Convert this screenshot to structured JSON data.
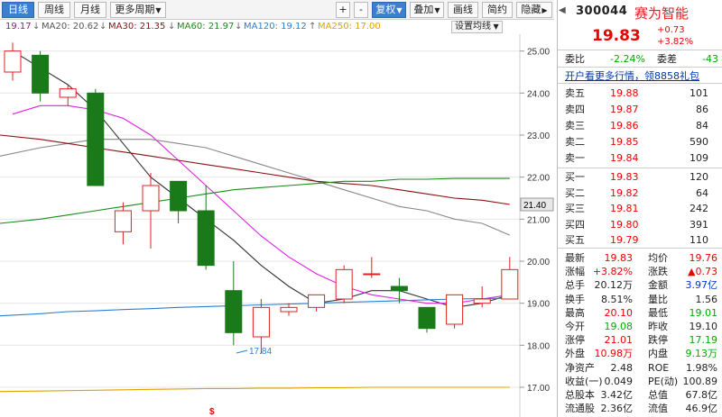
{
  "toolbar": {
    "tabs": [
      {
        "label": "日线",
        "active": true
      },
      {
        "label": "周线",
        "active": false
      },
      {
        "label": "月线",
        "active": false
      },
      {
        "label": "更多周期",
        "active": false
      }
    ],
    "buttons": [
      "+",
      "-",
      "复权",
      "叠加",
      "画线",
      "简约",
      "隐藏"
    ]
  },
  "ma": {
    "price": {
      "label": "19.17",
      "color": "#8b1a8b"
    },
    "ma20": {
      "label": "MA20: 20.62",
      "color": "#555555"
    },
    "ma30": {
      "label": "MA30: 21.35",
      "color": "#8b1010"
    },
    "ma60": {
      "label": "MA60: 21.97",
      "color": "#1a8a1a"
    },
    "ma120": {
      "label": "MA120: 19.12",
      "color": "#2a7fd4"
    },
    "ma250": {
      "label": "MA250: 17.00",
      "color": "#e0a000"
    },
    "settings": "设置均线"
  },
  "chart_data": {
    "type": "candlestick",
    "yticks": [
      "25.00",
      "24.00",
      "23.00",
      "22.00",
      "21.00",
      "20.00",
      "19.00",
      "18.00",
      "17.00"
    ],
    "ylim": [
      16.4,
      25.4
    ],
    "current_label": "21.40",
    "low_marker": "17.84",
    "candles": [
      {
        "o": 24.5,
        "h": 25.2,
        "l": 24.3,
        "c": 25.0
      },
      {
        "o": 24.9,
        "h": 25.0,
        "l": 23.8,
        "c": 24.0
      },
      {
        "o": 23.9,
        "h": 24.2,
        "l": 23.7,
        "c": 24.1
      },
      {
        "o": 24.0,
        "h": 24.1,
        "l": 21.8,
        "c": 21.8
      },
      {
        "o": 20.7,
        "h": 21.4,
        "l": 20.4,
        "c": 21.2
      },
      {
        "o": 21.2,
        "h": 22.1,
        "l": 20.3,
        "c": 21.8
      },
      {
        "o": 21.9,
        "h": 21.9,
        "l": 20.9,
        "c": 21.2
      },
      {
        "o": 21.2,
        "h": 21.8,
        "l": 19.8,
        "c": 19.9
      },
      {
        "o": 19.3,
        "h": 20.0,
        "l": 18.0,
        "c": 18.3
      },
      {
        "o": 18.2,
        "h": 19.1,
        "l": 17.8,
        "c": 18.9
      },
      {
        "o": 18.8,
        "h": 19.0,
        "l": 18.7,
        "c": 18.9
      },
      {
        "o": 18.9,
        "h": 19.2,
        "l": 18.8,
        "c": 19.2
      },
      {
        "o": 19.1,
        "h": 19.9,
        "l": 19.0,
        "c": 19.8
      },
      {
        "o": 19.7,
        "h": 20.1,
        "l": 19.6,
        "c": 19.7
      },
      {
        "o": 19.4,
        "h": 19.6,
        "l": 19.0,
        "c": 19.3
      },
      {
        "o": 18.9,
        "h": 18.9,
        "l": 18.3,
        "c": 18.4
      },
      {
        "o": 18.5,
        "h": 19.2,
        "l": 18.4,
        "c": 19.2
      },
      {
        "o": 19.0,
        "h": 19.4,
        "l": 18.9,
        "c": 19.1
      },
      {
        "o": 19.1,
        "h": 20.1,
        "l": 19.1,
        "c": 19.8
      }
    ],
    "ma_lines": {
      "ma5": [
        25.0,
        24.6,
        24.2,
        23.6,
        22.8,
        22.0,
        21.5,
        21.0,
        20.5,
        19.9,
        19.4,
        19.0,
        19.1,
        19.3,
        19.3,
        19.1,
        18.9,
        19.0,
        19.2
      ],
      "ma10": [
        23.5,
        23.7,
        23.7,
        23.6,
        23.4,
        23.0,
        22.4,
        21.8,
        21.2,
        20.6,
        20.1,
        19.7,
        19.4,
        19.2,
        19.1,
        19.0,
        19.0,
        19.1,
        19.2
      ],
      "ma20": [
        22.5,
        22.7,
        22.8,
        22.9,
        22.9,
        22.9,
        22.8,
        22.7,
        22.5,
        22.3,
        22.1,
        21.9,
        21.7,
        21.5,
        21.3,
        21.2,
        21.0,
        20.9,
        20.62
      ],
      "ma30": [
        23.0,
        22.9,
        22.8,
        22.7,
        22.6,
        22.5,
        22.4,
        22.3,
        22.2,
        22.1,
        22.0,
        21.9,
        21.85,
        21.8,
        21.7,
        21.6,
        21.5,
        21.45,
        21.35
      ],
      "ma60": [
        20.9,
        21.0,
        21.1,
        21.2,
        21.3,
        21.4,
        21.5,
        21.6,
        21.7,
        21.75,
        21.8,
        21.85,
        21.9,
        21.9,
        21.95,
        21.95,
        21.97,
        21.97,
        21.97
      ],
      "ma120": [
        18.7,
        18.75,
        18.8,
        18.82,
        18.85,
        18.87,
        18.9,
        18.92,
        18.94,
        18.96,
        18.98,
        19.0,
        19.02,
        19.04,
        19.06,
        19.08,
        19.1,
        19.11,
        19.12
      ],
      "ma250": [
        16.9,
        16.91,
        16.92,
        16.93,
        16.94,
        16.95,
        16.96,
        16.97,
        16.97,
        16.98,
        16.98,
        16.99,
        16.99,
        17.0,
        17.0,
        17.0,
        17.0,
        17.0,
        17.0
      ]
    }
  },
  "panel": {
    "code": "300044",
    "name": "赛为智能",
    "price": "19.83",
    "change": "+0.73",
    "change_pct": "+3.82%",
    "weibi": {
      "label": "委比",
      "value": "-2.24%",
      "label2": "委差",
      "value2": "-43"
    },
    "promo": "开户看更多行情，领8858礼包",
    "sells": [
      {
        "label": "卖五",
        "price": "19.88",
        "vol": "101"
      },
      {
        "label": "卖四",
        "price": "19.87",
        "vol": "86"
      },
      {
        "label": "卖三",
        "price": "19.86",
        "vol": "84"
      },
      {
        "label": "卖二",
        "price": "19.85",
        "vol": "590"
      },
      {
        "label": "卖一",
        "price": "19.84",
        "vol": "109"
      }
    ],
    "buys": [
      {
        "label": "买一",
        "price": "19.83",
        "vol": "120"
      },
      {
        "label": "买二",
        "price": "19.82",
        "vol": "64"
      },
      {
        "label": "买三",
        "price": "19.81",
        "vol": "242"
      },
      {
        "label": "买四",
        "price": "19.80",
        "vol": "391"
      },
      {
        "label": "买五",
        "price": "19.79",
        "vol": "110"
      }
    ],
    "stats": [
      {
        "l1": "最新",
        "v1": "19.83",
        "c1": "red",
        "l2": "均价",
        "v2": "19.76",
        "c2": "red"
      },
      {
        "l1": "涨幅",
        "v1": "+3.82%",
        "c1": "red",
        "l2": "涨跌",
        "v2": "▲0.73",
        "c2": "red"
      },
      {
        "l1": "总手",
        "v1": "20.12万",
        "c1": "",
        "l2": "金额",
        "v2": "3.97亿",
        "c2": "blue"
      },
      {
        "l1": "换手",
        "v1": "8.51%",
        "c1": "",
        "l2": "量比",
        "v2": "1.56",
        "c2": ""
      },
      {
        "l1": "最高",
        "v1": "20.10",
        "c1": "red",
        "l2": "最低",
        "v2": "19.01",
        "c2": "green"
      },
      {
        "l1": "今开",
        "v1": "19.08",
        "c1": "green",
        "l2": "昨收",
        "v2": "19.10",
        "c2": ""
      },
      {
        "l1": "涨停",
        "v1": "21.01",
        "c1": "red",
        "l2": "跌停",
        "v2": "17.19",
        "c2": "green"
      },
      {
        "l1": "外盘",
        "v1": "10.98万",
        "c1": "red",
        "l2": "内盘",
        "v2": "9.13万",
        "c2": "green"
      },
      {
        "l1": "净资产",
        "v1": "2.48",
        "c1": "",
        "l2": "ROE",
        "v2": "1.98%",
        "c2": ""
      },
      {
        "l1": "收益(一)",
        "v1": "0.049",
        "c1": "",
        "l2": "PE(动)",
        "v2": "100.89",
        "c2": ""
      },
      {
        "l1": "总股本",
        "v1": "3.42亿",
        "c1": "",
        "l2": "总值",
        "v2": "67.8亿",
        "c2": ""
      },
      {
        "l1": "流通股",
        "v1": "2.36亿",
        "c1": "",
        "l2": "流值",
        "v2": "46.9亿",
        "c2": ""
      }
    ]
  }
}
